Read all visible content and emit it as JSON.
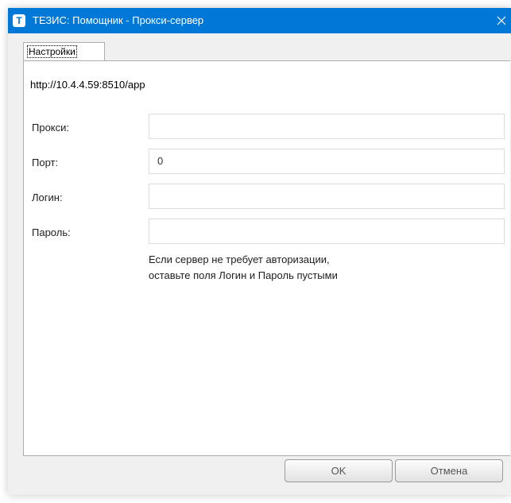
{
  "window": {
    "title": "ТЕЗИС: Помощник - Прокси-сервер",
    "app_icon_letter": "T"
  },
  "tabs": [
    {
      "label": "Настройки",
      "active": true
    }
  ],
  "server_url": "http://10.4.4.59:8510/app",
  "fields": {
    "proxy": {
      "label": "Прокси:",
      "value": ""
    },
    "port": {
      "label": "Порт:",
      "value": "0"
    },
    "login": {
      "label": "Логин:",
      "value": ""
    },
    "password": {
      "label": "Пароль:",
      "value": ""
    }
  },
  "hint": {
    "line1": "Если сервер не требует авторизации,",
    "line2": "оставьте поля Логин и Пароль пустыми"
  },
  "buttons": {
    "ok": "OK",
    "cancel": "Отмена"
  },
  "colors": {
    "titlebar": "#0078d7",
    "window_bg": "#f0f0f0",
    "panel_bg": "#ffffff"
  }
}
